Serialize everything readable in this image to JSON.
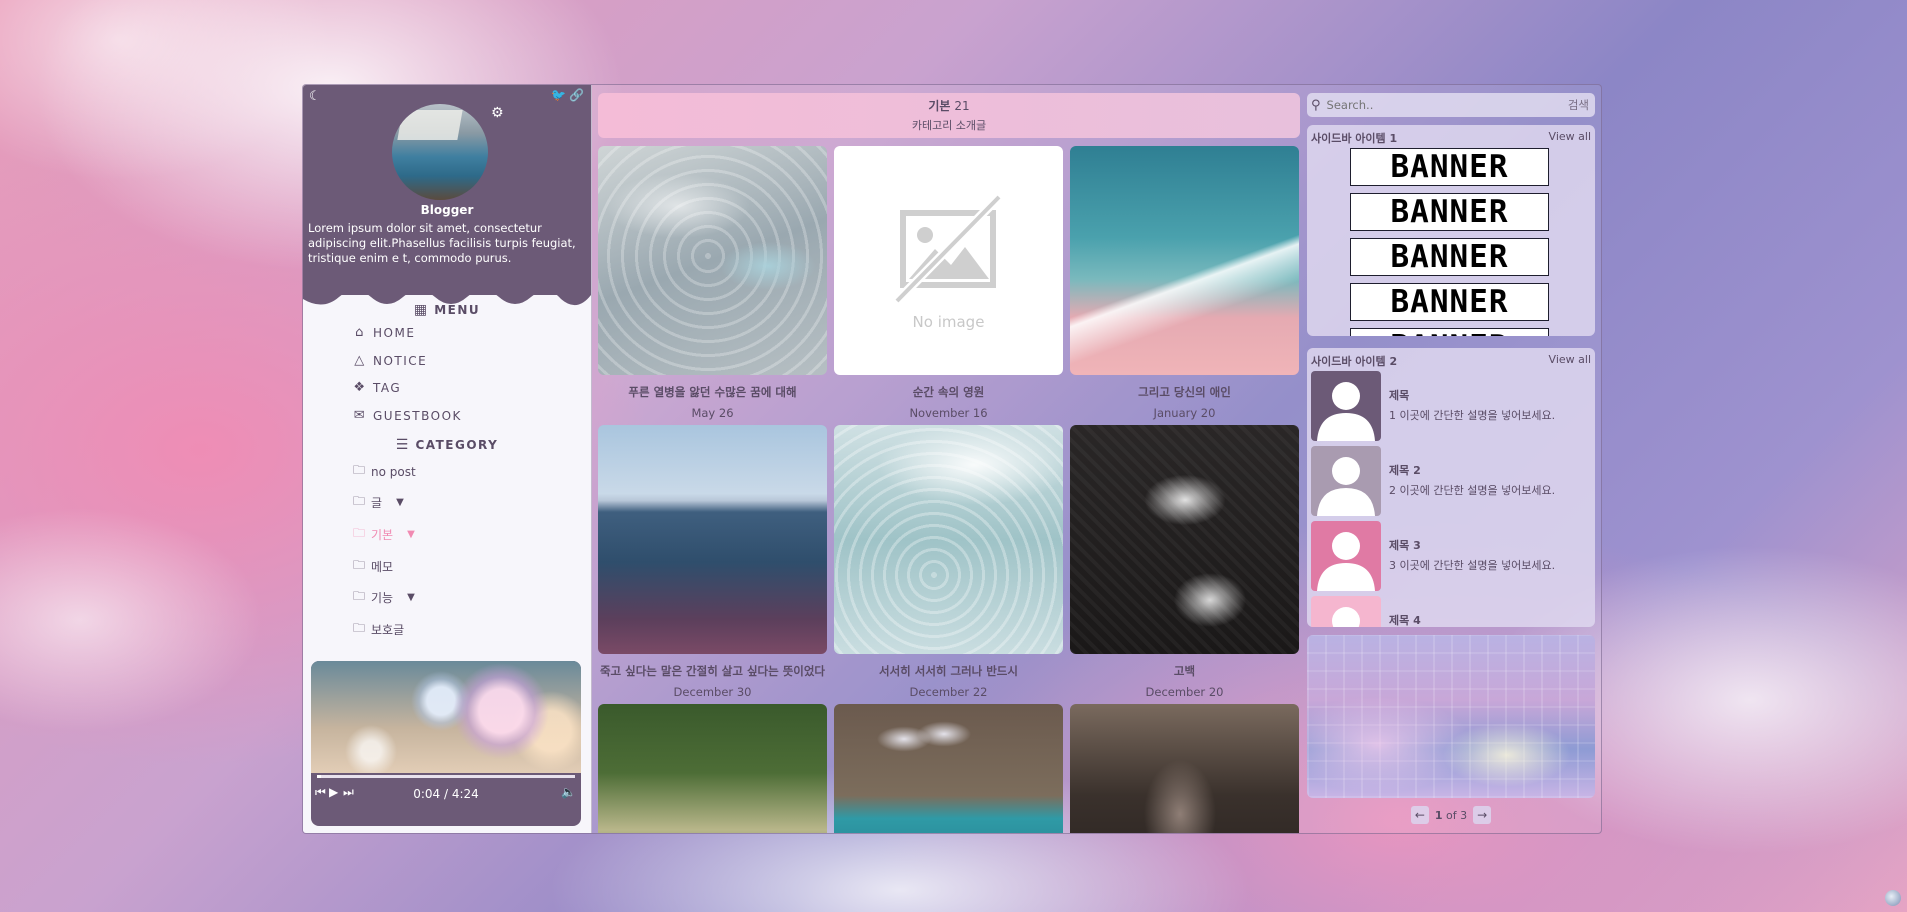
{
  "profile": {
    "name": "Blogger",
    "bio": "Lorem ipsum dolor sit amet, consectetur adipiscing elit.Phasellus facilisis turpis feugiat, tristique enim e t, commodo purus."
  },
  "menu": {
    "title": "MENU",
    "items": [
      {
        "label": "HOME",
        "icon": "home-icon"
      },
      {
        "label": "NOTICE",
        "icon": "bell-icon"
      },
      {
        "label": "TAG",
        "icon": "tag-icon"
      },
      {
        "label": "GUESTBOOK",
        "icon": "mail-icon"
      }
    ]
  },
  "category": {
    "title": "CATEGORY",
    "items": [
      {
        "label": "no post",
        "has_caret": false,
        "active": false
      },
      {
        "label": "글",
        "has_caret": true,
        "active": false
      },
      {
        "label": "기본",
        "has_caret": true,
        "active": true
      },
      {
        "label": "메모",
        "has_caret": false,
        "active": false
      },
      {
        "label": "기능",
        "has_caret": true,
        "active": false
      },
      {
        "label": "보호글",
        "has_caret": false,
        "active": false
      }
    ]
  },
  "player": {
    "time": "0:04 / 4:24",
    "progress": 0.015
  },
  "main": {
    "category_name": "기본",
    "category_count": "21",
    "category_desc": "카테고리 소개글",
    "no_image_text": "No image",
    "posts": [
      {
        "title": "푸른 열병을 앓던 수많은 꿈에 대해",
        "date": "May 26"
      },
      {
        "title": "순간 속의 영원",
        "date": "November 16"
      },
      {
        "title": "그리고 당신의 애인",
        "date": "January 20"
      },
      {
        "title": "죽고 싶다는 말은 간절히 살고 싶다는 뜻이었다",
        "date": "December 30"
      },
      {
        "title": "서서히 서서히 그러나 반드시",
        "date": "December 22"
      },
      {
        "title": "고백",
        "date": "December 20"
      },
      {
        "title": "",
        "date": ""
      },
      {
        "title": "",
        "date": ""
      },
      {
        "title": "",
        "date": ""
      }
    ]
  },
  "right": {
    "search_placeholder": "Search..",
    "search_button": "검색",
    "panel1": {
      "title": "사이드바 아이템 1",
      "view_all": "View all",
      "banner_text": "BANNER"
    },
    "panel2": {
      "title": "사이드바 아이템 2",
      "view_all": "View all",
      "items": [
        {
          "title": "제목",
          "desc": "1 이곳에 간단한 설명을 넣어보세요.",
          "color": "#6c5a77"
        },
        {
          "title": "제목 2",
          "desc": "2 이곳에 간단한 설명을 넣어보세요.",
          "color": "#a99bb0"
        },
        {
          "title": "제목 3",
          "desc": "3 이곳에 간단한 설명을 넣어보세요.",
          "color": "#e07aa4"
        },
        {
          "title": "제목 4",
          "desc": "",
          "color": "#f5b6cf"
        }
      ]
    },
    "pager": {
      "current": "1",
      "of_text": "of 3"
    }
  }
}
